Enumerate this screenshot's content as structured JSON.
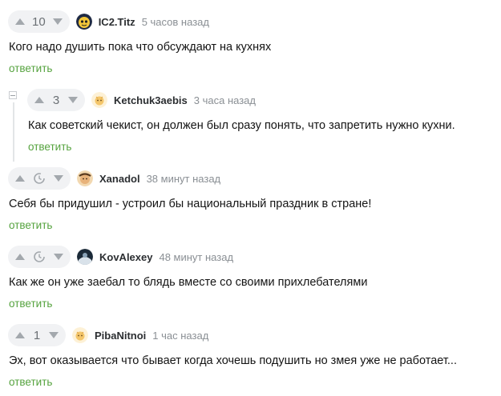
{
  "comments": [
    {
      "score": "10",
      "nick": "IC2.Titz",
      "time": "5 часов назад",
      "text": "Кого надо душить пока что обсуждают на кухнях",
      "reply": "ответить",
      "avatar_icon": "cartoon-face-avatar-icon"
    },
    {
      "score": "3",
      "nick": "Ketchuk3aebis",
      "time": "3 часа назад",
      "text": "Как советский чекист, он должен был сразу понять, что запретить нужно кухни.",
      "reply": "ответить",
      "avatar_icon": "default-avatar-icon"
    },
    {
      "score": "",
      "nick": "Xanadol",
      "time": "38 минут назад",
      "text": "Себя бы придушил - устроил бы национальный праздник в стране!",
      "reply": "ответить",
      "avatar_icon": "face-avatar-icon"
    },
    {
      "score": "",
      "nick": "KovAlexey",
      "time": "48 минут назад",
      "text": "Как же он уже заебал то блядь вместе со своими прихлебателями",
      "reply": "ответить",
      "avatar_icon": "dark-avatar-icon"
    },
    {
      "score": "1",
      "nick": "PibaNitnoi",
      "time": "1 час назад",
      "text": "Эх, вот оказывается что бывает когда хочешь подушить но змея уже не работает...",
      "reply": "ответить",
      "avatar_icon": "default-avatar-icon"
    }
  ],
  "colors": {
    "reply_link": "#56a33f",
    "vote_bg": "#f1f2f4",
    "arrow": "#a3a8ad"
  }
}
